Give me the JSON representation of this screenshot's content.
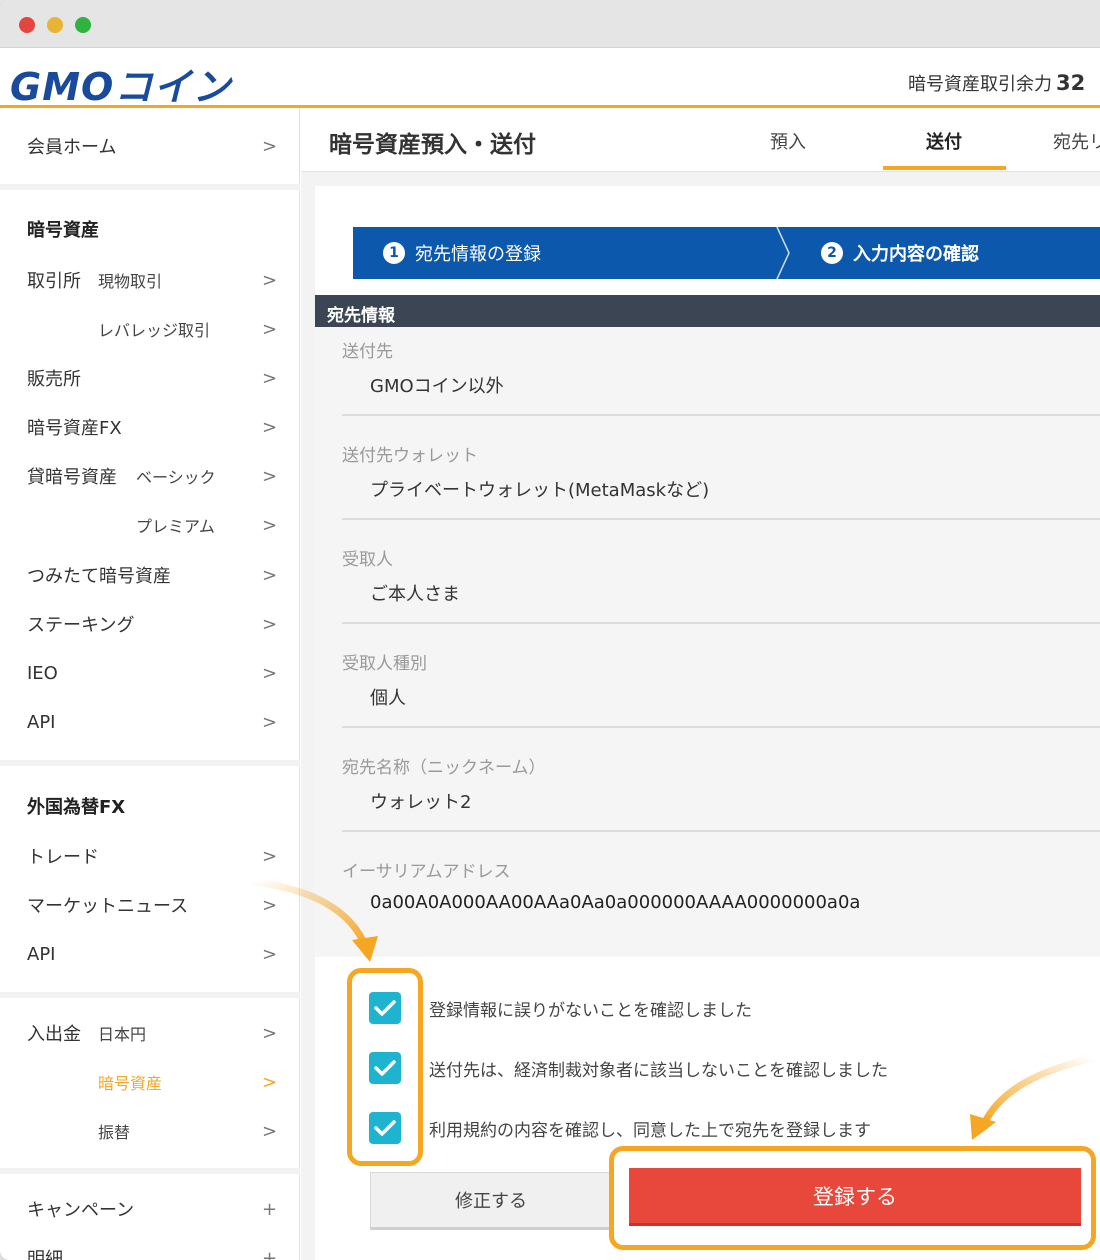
{
  "header": {
    "logo_main": "GMO",
    "logo_kana": "コイン",
    "balance_label": "暗号資産取引余力",
    "balance_value": "32"
  },
  "sidebar": {
    "home": "会員ホーム",
    "section_crypto": "暗号資産",
    "exchange_label": "取引所",
    "exchange_spot": "現物取引",
    "exchange_leverage": "レバレッジ取引",
    "sales": "販売所",
    "crypto_fx": "暗号資産FX",
    "lending_label": "貸暗号資産",
    "lending_basic": "ベーシック",
    "lending_premium": "プレミアム",
    "tsumitate": "つみたて暗号資産",
    "staking": "ステーキング",
    "ieo": "IEO",
    "api": "API",
    "section_fx": "外国為替FX",
    "fx_trade": "トレード",
    "fx_news": "マーケットニュース",
    "fx_api": "API",
    "deposit_label": "入出金",
    "deposit_jpy": "日本円",
    "deposit_crypto": "暗号資産",
    "deposit_transfer": "振替",
    "campaign": "キャンペーン",
    "details": "明細",
    "chevron": ">",
    "plus": "+"
  },
  "main": {
    "title": "暗号資産預入・送付",
    "tabs": [
      {
        "label": "預入"
      },
      {
        "label": "送付"
      },
      {
        "label": "宛先リ"
      }
    ],
    "steps": [
      {
        "num": "1",
        "label": "宛先情報の登録"
      },
      {
        "num": "2",
        "label": "入力内容の確認"
      }
    ],
    "section_title": "宛先情報",
    "fields": [
      {
        "label": "送付先",
        "value": "GMOコイン以外"
      },
      {
        "label": "送付先ウォレット",
        "value": "プライベートウォレット(MetaMaskなど)"
      },
      {
        "label": "受取人",
        "value": "ご本人さま"
      },
      {
        "label": "受取人種別",
        "value": "個人"
      },
      {
        "label": "宛先名称（ニックネーム）",
        "value": "ウォレット2"
      },
      {
        "label": "イーサリアムアドレス",
        "value": "0a00A0A000AA00AAa0Aa0a000000AAAA0000000a0a"
      }
    ],
    "checks": [
      {
        "label": "登録情報に誤りがないことを確認しました"
      },
      {
        "label": "送付先は、経済制裁対象者に該当しないことを確認しました"
      },
      {
        "label": "利用規約の内容を確認し、同意した上で宛先を登録します"
      }
    ],
    "btn_fix": "修正する",
    "btn_register": "登録する"
  },
  "colors": {
    "brand_blue": "#1a4a9c",
    "accent_orange": "#f5a623",
    "step_blue": "#0b58ad",
    "check_cyan": "#1eb3cf",
    "register_red": "#e8483b"
  }
}
